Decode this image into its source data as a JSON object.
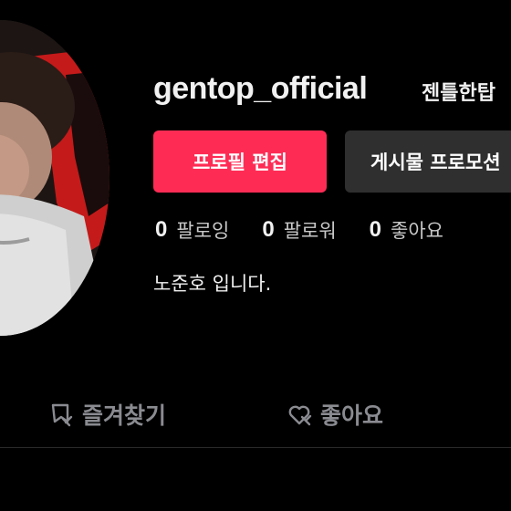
{
  "profile": {
    "username": "gentop_official",
    "nickname": "젠틀한탑",
    "bio": "노준호 입니다."
  },
  "actions": {
    "edit_label": "프로필 편집",
    "promote_label": "게시물 프로모션"
  },
  "stats": {
    "following_count": "0",
    "following_label": "팔로잉",
    "followers_count": "0",
    "followers_label": "팔로워",
    "likes_count": "0",
    "likes_label": "좋아요"
  },
  "tabs": {
    "favorites_label": "즐겨찾기",
    "favorites_icon": "bookmark-icon",
    "likes_label": "좋아요",
    "likes_icon": "heart-icon"
  },
  "colors": {
    "accent": "#fe2c55",
    "secondary_button": "#2f2f2f",
    "background": "#000000",
    "tab_inactive": "#8a8b91"
  }
}
